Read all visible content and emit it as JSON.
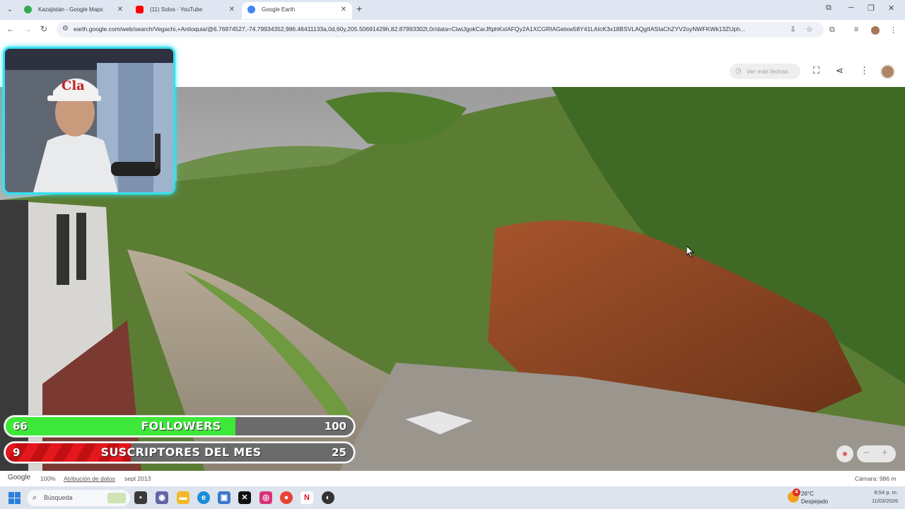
{
  "browser": {
    "tabs": [
      {
        "title": "Kazajistán - Google Maps",
        "active": false,
        "favicon_color": "#34a853"
      },
      {
        "title": "(11) Solos - YouTube",
        "active": false,
        "favicon_color": "#ff0000"
      },
      {
        "title": "Google Earth",
        "active": true,
        "favicon_color": "#4285f4"
      }
    ],
    "url": "earth.google.com/web/search/Vegachi,+Antioquia/@6.76974527,-74.79934352,986.46411133a,0d,60y,205.50691429h,82.87993302t,0r/data=CiwiJgokCarJftphKxIAFQy2A1XCGRIAGetxw58Y41LAIcK3x18BSVLAQgIIASIaChZYV2oyNWFKWk13ZUph..."
  },
  "earth": {
    "history_label": "Ver más fechas",
    "footer": {
      "logo": "Google",
      "zoom": "100%",
      "attribution": "Atribución de datos",
      "date": "sept 2013",
      "camera": "Cámara: 986 m"
    }
  },
  "stream": {
    "followers": {
      "current": "66",
      "label": "FOLLOWERS",
      "target": "100",
      "progress": 0.66,
      "color": "#3ee83a"
    },
    "subs": {
      "current": "9",
      "label": "SUSCRIPTORES DEL MES",
      "target": "25",
      "progress": 0.36,
      "color": "#e3171c"
    }
  },
  "taskbar": {
    "search_placeholder": "Búsqueda",
    "weather_badge": "4",
    "temperature": "26°C",
    "condition": "Despejado",
    "time": "8:54 p. m.",
    "date": "11/03/2026"
  }
}
